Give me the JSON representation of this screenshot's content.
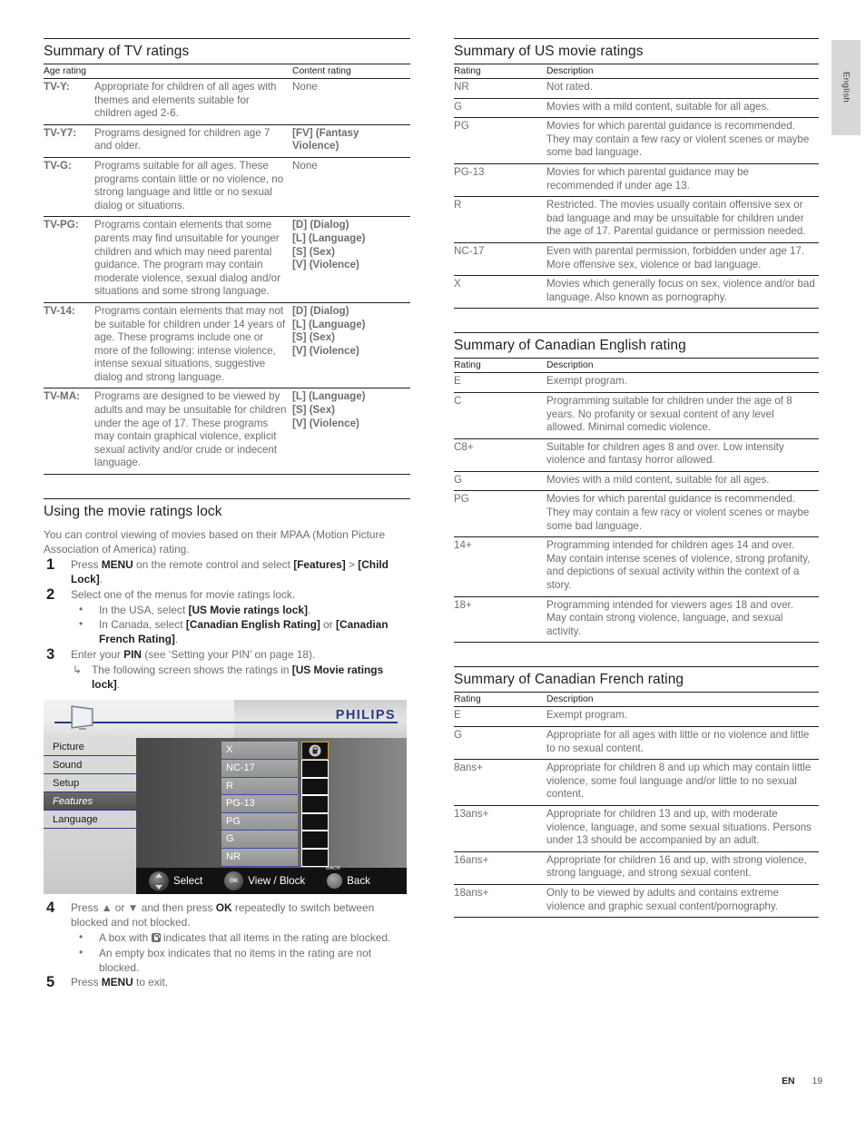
{
  "page": {
    "side_tab": "English",
    "footer_lang": "EN",
    "footer_page": "19"
  },
  "tv_ratings": {
    "title": "Summary of TV ratings",
    "headers": [
      "Age rating",
      "Content rating"
    ],
    "rows": [
      {
        "code": "TV-Y:",
        "description": "Appropriate for children of all ages with themes and elements suitable for children aged 2-6.",
        "content": [
          "None"
        ],
        "content_plain": true
      },
      {
        "code": "TV-Y7:",
        "description": "Programs designed for children age 7 and older.",
        "content": [
          "[FV] (Fantasy Violence)"
        ],
        "content_plain": false
      },
      {
        "code": "TV-G:",
        "description": "Programs suitable for all ages. These programs contain little or no violence, no strong language and little or no sexual dialog or situations.",
        "content": [
          "None"
        ],
        "content_plain": true
      },
      {
        "code": "TV-PG:",
        "description": "Programs contain elements that some parents may find unsuitable for younger children and which may need parental guidance. The program may contain moderate violence, sexual dialog and/or situations and some strong language.",
        "content": [
          "[D] (Dialog)",
          "[L] (Language)",
          "[S] (Sex)",
          "[V] (Violence)"
        ],
        "content_plain": false
      },
      {
        "code": "TV-14:",
        "description": "Programs contain elements that may not be suitable for children under 14 years of age. These programs include one or more of the following: intense violence, intense sexual situations, suggestive dialog and strong language.",
        "content": [
          "[D] (Dialog)",
          "[L] (Language)",
          "[S] (Sex)",
          "[V] (Violence)"
        ],
        "content_plain": false
      },
      {
        "code": "TV-MA:",
        "description": "Programs are designed to be viewed by adults and may be unsuitable for children under the age of 17. These programs may contain graphical violence, explicit sexual activity and/or crude or indecent language.",
        "content": [
          "[L] (Language)",
          "[S] (Sex)",
          "[V] (Violence)"
        ],
        "content_plain": false
      }
    ]
  },
  "movie_lock": {
    "title": "Using the movie ratings lock",
    "intro": "You can control viewing of movies based on their MPAA (Motion Picture Association of America) rating.",
    "step1": {
      "num": "1",
      "t1": "Press ",
      "b1": "MENU",
      "t2": " on the remote control and select ",
      "b2": "[Features]",
      "t3": " > ",
      "b3": "[Child Lock]",
      "t4": "."
    },
    "step2": {
      "num": "2",
      "text": "Select one of the menus for movie ratings lock.",
      "bullets": [
        {
          "t1": "In the USA, select ",
          "b1": "[US Movie ratings lock]",
          "t2": "."
        },
        {
          "t1": "In Canada, select ",
          "b1": "[Canadian English Rating]",
          "t2": " or ",
          "b2": "[Canadian French Rating]",
          "t3": "."
        }
      ]
    },
    "step3": {
      "num": "3",
      "t1": "Enter your ",
      "b1": "PIN",
      "t2": " (see ‘Setting your PIN’ on page 18).",
      "arrow": {
        "t1": "The following screen shows the ratings in ",
        "b1": "[US Movie ratings lock]",
        "t2": "."
      }
    },
    "step4": {
      "num": "4",
      "t1": "Press ",
      "t2": " or ",
      "t3": " and then press ",
      "b1": "OK",
      "t4": " repeatedly to switch between blocked and not blocked.",
      "bullets": [
        {
          "t1": "A box with ",
          "icon": "lock-icon",
          "t2": " indicates that all items in the rating are blocked."
        },
        {
          "t1": "An empty box indicates that no items in the rating are not blocked."
        }
      ]
    },
    "step5": {
      "num": "5",
      "t1": "Press ",
      "b1": "MENU",
      "t2": " to exit."
    }
  },
  "osd": {
    "brand": "PHILIPS",
    "menu_items": [
      {
        "label": "Picture",
        "selected": false
      },
      {
        "label": "Sound",
        "selected": false
      },
      {
        "label": "Setup",
        "selected": false
      },
      {
        "label": "Features",
        "selected": true
      },
      {
        "label": "Language",
        "selected": false
      }
    ],
    "ratings": [
      {
        "label": "X",
        "locked": true,
        "highlighted": true
      },
      {
        "label": "NC-17",
        "locked": false,
        "highlighted": false
      },
      {
        "label": "R",
        "locked": false,
        "highlighted": false
      },
      {
        "label": "PG-13",
        "locked": false,
        "highlighted": false
      },
      {
        "label": "PG",
        "locked": false,
        "highlighted": false
      },
      {
        "label": "G",
        "locked": false,
        "highlighted": false
      },
      {
        "label": "NR",
        "locked": false,
        "highlighted": false
      }
    ],
    "hints": [
      {
        "icon": "dpad-icon",
        "label": "Select"
      },
      {
        "icon": "ok-button-icon",
        "label": "View / Block"
      },
      {
        "icon": "back-button-icon",
        "label": "Back",
        "cap": "BACK"
      }
    ],
    "colors": {
      "brand_blue": "#2b3a8f",
      "highlight_orange": "#e0a13a"
    }
  },
  "us_movie_ratings": {
    "title": "Summary of US movie ratings",
    "headers": [
      "Rating",
      "Description"
    ],
    "rows": [
      {
        "rating": "NR",
        "description": "Not rated."
      },
      {
        "rating": "G",
        "description": "Movies with a mild content, suitable for all ages."
      },
      {
        "rating": "PG",
        "description": "Movies for which parental guidance is recommended. They may contain a few racy or violent scenes or maybe some bad language."
      },
      {
        "rating": "PG-13",
        "description": "Movies for which parental guidance may be recommended if under age 13."
      },
      {
        "rating": "R",
        "description": "Restricted. The movies usually contain offensive sex or bad language and may be unsuitable for children under the age of 17. Parental guidance or permission needed."
      },
      {
        "rating": "NC-17",
        "description": "Even with parental permission, forbidden under age 17. More offensive sex, violence or bad language."
      },
      {
        "rating": "X",
        "description": "Movies which generally focus on sex, violence and/or bad language. Also known as pornography."
      }
    ]
  },
  "canadian_english": {
    "title": "Summary of Canadian English rating",
    "headers": [
      "Rating",
      "Description"
    ],
    "rows": [
      {
        "rating": "E",
        "description": "Exempt program."
      },
      {
        "rating": "C",
        "description": "Programming suitable for children under the age of 8 years. No profanity or sexual content of any level allowed. Minimal comedic violence."
      },
      {
        "rating": "C8+",
        "description": "Suitable for children ages 8 and over. Low intensity violence and fantasy horror allowed."
      },
      {
        "rating": "G",
        "description": "Movies with a mild content, suitable for all ages."
      },
      {
        "rating": "PG",
        "description": "Movies for which parental guidance is recommended. They may contain a few racy or violent scenes or maybe some bad language."
      },
      {
        "rating": "14+",
        "description": "Programming intended for children ages 14 and over. May contain intense scenes of violence, strong profanity, and depictions of sexual activity within the context of a story."
      },
      {
        "rating": "18+",
        "description": "Programming intended for viewers ages 18 and over. May contain strong violence, language, and sexual activity."
      }
    ]
  },
  "canadian_french": {
    "title": "Summary of Canadian French rating",
    "headers": [
      "Rating",
      "Description"
    ],
    "rows": [
      {
        "rating": "E",
        "description": "Exempt program."
      },
      {
        "rating": "G",
        "description": "Appropriate for all ages with little or no violence and little to no sexual content."
      },
      {
        "rating": "8ans+",
        "description": "Appropriate for children 8 and up which may contain little violence, some foul language and/or little to no sexual content."
      },
      {
        "rating": "13ans+",
        "description": "Appropriate for children 13 and up, with moderate violence, language, and some sexual situations. Persons under 13 should be accompanied by an adult."
      },
      {
        "rating": "16ans+",
        "description": "Appropriate for children 16 and up, with strong violence, strong language, and strong sexual content."
      },
      {
        "rating": "18ans+",
        "description": "Only to be viewed by adults and contains extreme violence and graphic sexual content/pornography."
      }
    ]
  }
}
